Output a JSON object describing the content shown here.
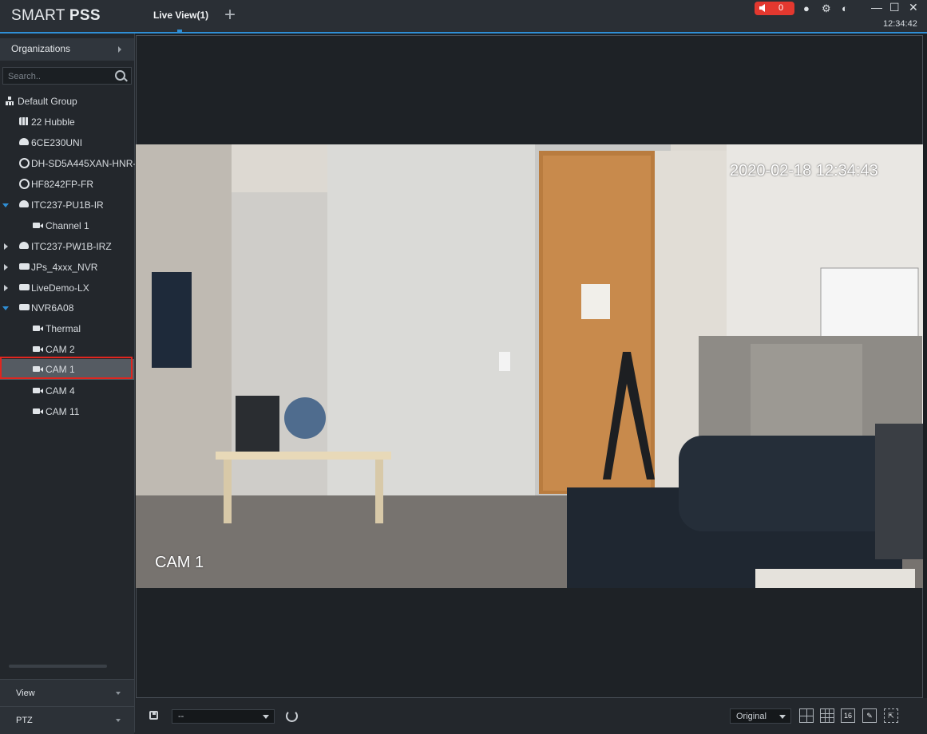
{
  "app": {
    "name_light": "SMART ",
    "name_bold": "PSS"
  },
  "tabs": [
    {
      "label": "Live View(1)"
    }
  ],
  "titlebar": {
    "alarm_count": "0",
    "time": "12:34:42",
    "colors": {
      "accent": "#2f8fd6",
      "alarm": "#e3382f"
    }
  },
  "sidebar": {
    "organizations_label": "Organizations",
    "search_placeholder": "Search..",
    "tree": [
      {
        "label": "Default Group",
        "icon": "group-icon"
      },
      {
        "label": "22 Hubble",
        "icon": "map-icon"
      },
      {
        "label": "6CE230UNI",
        "icon": "dome-camera-icon"
      },
      {
        "label": "DH-SD5A445XAN-HNR-",
        "icon": "ptz-camera-icon"
      },
      {
        "label": "HF8242FP-FR",
        "icon": "ptz-camera-icon"
      },
      {
        "label": "ITC237-PU1B-IR",
        "icon": "dome-camera-icon",
        "expanded": true
      },
      {
        "label": "Channel 1",
        "icon": "camera-icon"
      },
      {
        "label": "ITC237-PW1B-IRZ",
        "icon": "dome-camera-icon",
        "expanded": false
      },
      {
        "label": "JPs_4xxx_NVR",
        "icon": "nvr-icon",
        "expanded": false
      },
      {
        "label": "LiveDemo-LX",
        "icon": "nvr-icon",
        "expanded": false
      },
      {
        "label": "NVR6A08",
        "icon": "nvr-icon",
        "expanded": true
      },
      {
        "label": "Thermal",
        "icon": "camera-icon"
      },
      {
        "label": "CAM 2",
        "icon": "camera-icon"
      },
      {
        "label": "CAM 1",
        "icon": "camera-icon",
        "selected": true
      },
      {
        "label": "CAM 4",
        "icon": "camera-icon"
      },
      {
        "label": "CAM 11",
        "icon": "camera-icon"
      }
    ],
    "view_label": "View",
    "ptz_label": "PTZ"
  },
  "video": {
    "timestamp": "2020-02-18 12:34:43",
    "channel_label": "CAM 1"
  },
  "toolbar": {
    "select_value": "--",
    "ratio_value": "Original",
    "layout16_label": "16"
  }
}
